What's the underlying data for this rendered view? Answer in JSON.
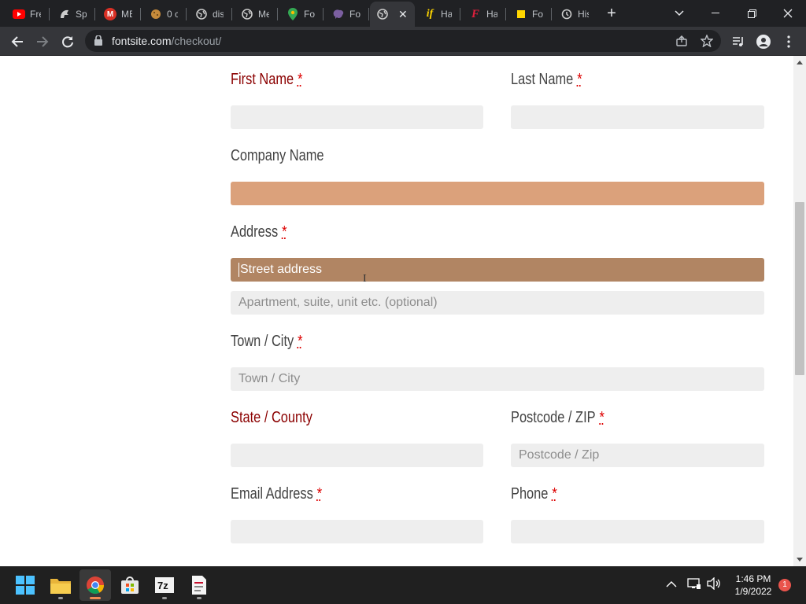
{
  "browser": {
    "tabs": [
      {
        "title": "Free",
        "icon": "youtube-icon",
        "color": "#ff0000"
      },
      {
        "title": "Spa",
        "icon": "spartan-icon",
        "color": "#cccccc"
      },
      {
        "title": "ME",
        "icon": "gmail-icon",
        "color": "#d93025"
      },
      {
        "title": "0 c",
        "icon": "cookie-icon",
        "color": "#c58a3b"
      },
      {
        "title": "disc",
        "icon": "globe-icon",
        "color": "#cccccc"
      },
      {
        "title": "Me",
        "icon": "globe-icon",
        "color": "#cccccc"
      },
      {
        "title": "For",
        "icon": "maps-pin-icon",
        "color": "#34a853"
      },
      {
        "title": "For",
        "icon": "purple-brain-icon",
        "color": "#7b5fa0"
      },
      {
        "title": "",
        "icon": "globe-icon",
        "color": "#cccccc",
        "active": true
      },
      {
        "title": "Ha",
        "icon": "if-logo-icon",
        "color": "#ffd600"
      },
      {
        "title": "Ha",
        "icon": "fontspring-icon",
        "color": "#e01f3d"
      },
      {
        "title": "For",
        "icon": "yellow-square-icon",
        "color": "#ffd600"
      },
      {
        "title": "His",
        "icon": "history-icon",
        "color": "#cccccc"
      }
    ],
    "url_domain": "fontsite.com",
    "url_path": "/checkout/"
  },
  "form": {
    "first_name": {
      "label": "First Name",
      "req": "*",
      "value": ""
    },
    "last_name": {
      "label": "Last Name",
      "req": "*",
      "value": ""
    },
    "company": {
      "label": "Company Name",
      "value": ""
    },
    "address": {
      "label": "Address",
      "req": "*",
      "street_placeholder": "Street address",
      "apt_placeholder": "Apartment, suite, unit etc. (optional)"
    },
    "city": {
      "label": "Town / City",
      "req": "*",
      "placeholder": "Town / City"
    },
    "state": {
      "label": "State / County",
      "value": ""
    },
    "postcode": {
      "label": "Postcode / ZIP",
      "req": "*",
      "placeholder": "Postcode / Zip"
    },
    "email": {
      "label": "Email Address",
      "req": "*",
      "value": ""
    },
    "phone": {
      "label": "Phone",
      "req": "*",
      "value": ""
    }
  },
  "taskbar": {
    "time": "1:46 PM",
    "date": "1/9/2022",
    "notifications": "1"
  }
}
